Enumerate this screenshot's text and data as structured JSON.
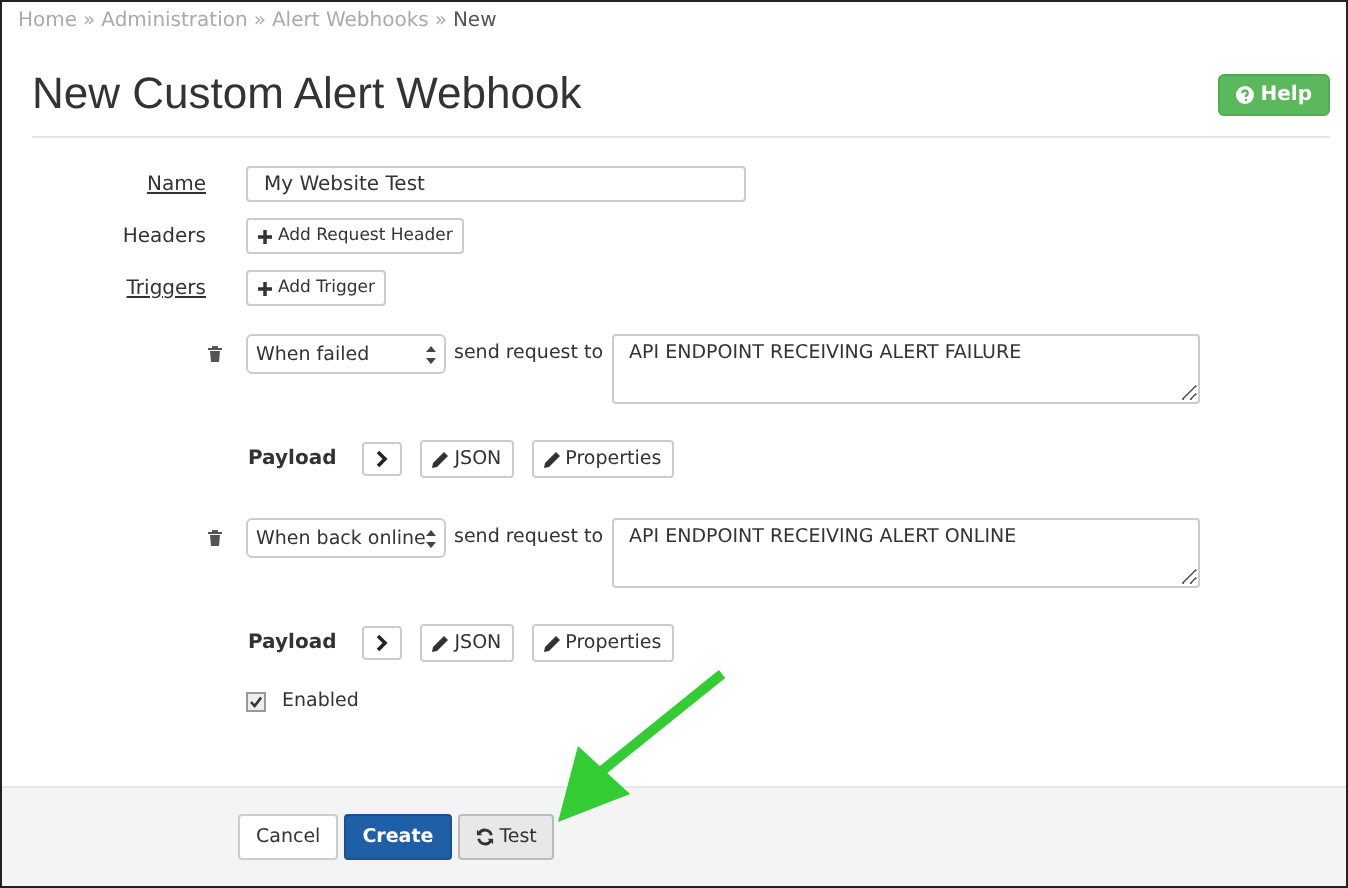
{
  "breadcrumb": [
    {
      "label": "Home",
      "current": false
    },
    {
      "label": "Administration",
      "current": false
    },
    {
      "label": "Alert Webhooks",
      "current": false
    },
    {
      "label": "New",
      "current": true
    }
  ],
  "breadcrumb_separator": "»",
  "title": "New Custom Alert Webhook",
  "help_button": "Help",
  "fields": [
    {
      "label": "Name",
      "kind": "input",
      "value": "My Website Test"
    },
    {
      "label": "Headers",
      "kind": "button",
      "button": "Add Request Header"
    },
    {
      "label": "Triggers",
      "kind": "button",
      "button": "Add Trigger"
    }
  ],
  "triggers": [
    {
      "event": "When failed",
      "send_label": "send request to",
      "endpoint": "API ENDPOINT RECEIVING ALERT FAILURE",
      "payload_label": "Payload",
      "buttons": [
        "JSON",
        "Properties"
      ]
    },
    {
      "event": "When back online",
      "send_label": "send request to",
      "endpoint": "API ENDPOINT RECEIVING ALERT ONLINE",
      "payload_label": "Payload",
      "buttons": [
        "JSON",
        "Properties"
      ]
    }
  ],
  "enabled": {
    "label": "Enabled",
    "checked": true
  },
  "footer_buttons": [
    {
      "label": "Cancel",
      "kind": "default"
    },
    {
      "label": "Create",
      "kind": "primary"
    },
    {
      "label": "Test",
      "kind": "test"
    }
  ]
}
